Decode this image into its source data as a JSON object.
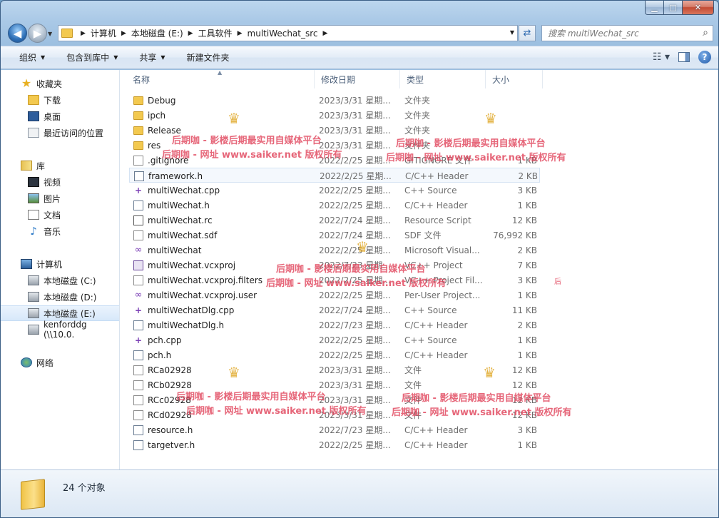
{
  "window": {
    "caption": {
      "minimize": "▁",
      "maximize": "□",
      "close": "✕"
    }
  },
  "nav": {
    "back_glyph": "◀",
    "forward_glyph": "▶",
    "breadcrumb": [
      "计算机",
      "本地磁盘 (E:)",
      "工具软件",
      "multiWechat_src"
    ],
    "search_placeholder": "搜索 multiWechat_src"
  },
  "toolbar": {
    "organize": "组织",
    "include_library": "包含到库中",
    "share": "共享",
    "new_folder": "新建文件夹"
  },
  "sidebar": {
    "favorites": {
      "label": "收藏夹",
      "items": [
        "下载",
        "桌面",
        "最近访问的位置"
      ]
    },
    "libraries": {
      "label": "库",
      "items": [
        "视频",
        "图片",
        "文档",
        "音乐"
      ]
    },
    "computer": {
      "label": "计算机",
      "items": [
        "本地磁盘 (C:)",
        "本地磁盘 (D:)",
        "本地磁盘 (E:)",
        "kenforddg (\\\\10.0."
      ]
    },
    "network": {
      "label": "网络"
    }
  },
  "columns": {
    "name": "名称",
    "date": "修改日期",
    "type": "类型",
    "size": "大小"
  },
  "files": [
    {
      "name": "Debug",
      "date": "2023/3/31 星期...",
      "type": "文件夹",
      "size": "",
      "icon": "folder-icon"
    },
    {
      "name": "ipch",
      "date": "2023/3/31 星期...",
      "type": "文件夹",
      "size": "",
      "icon": "folder-icon"
    },
    {
      "name": "Release",
      "date": "2023/3/31 星期...",
      "type": "文件夹",
      "size": "",
      "icon": "folder-icon"
    },
    {
      "name": "res",
      "date": "2023/3/31 星期...",
      "type": "文件夹",
      "size": "",
      "icon": "folder-icon"
    },
    {
      "name": ".gitignore",
      "date": "2022/2/25 星期...",
      "type": "GITIGNORE 文件",
      "size": "1 KB",
      "icon": "file-icon"
    },
    {
      "name": "framework.h",
      "date": "2022/2/25 星期...",
      "type": "C/C++ Header",
      "size": "2 KB",
      "icon": "header-file-icon"
    },
    {
      "name": "multiWechat.cpp",
      "date": "2022/2/25 星期...",
      "type": "C++ Source",
      "size": "3 KB",
      "icon": "cpp-file-icon"
    },
    {
      "name": "multiWechat.h",
      "date": "2022/2/25 星期...",
      "type": "C/C++ Header",
      "size": "1 KB",
      "icon": "header-file-icon"
    },
    {
      "name": "multiWechat.rc",
      "date": "2022/7/24 星期...",
      "type": "Resource Script",
      "size": "12 KB",
      "icon": "resource-script-icon"
    },
    {
      "name": "multiWechat.sdf",
      "date": "2022/7/24 星期...",
      "type": "SDF 文件",
      "size": "76,992 KB",
      "icon": "file-icon"
    },
    {
      "name": "multiWechat",
      "date": "2022/2/25 星期...",
      "type": "Microsoft Visual...",
      "size": "2 KB",
      "icon": "visual-studio-icon"
    },
    {
      "name": "multiWechat.vcxproj",
      "date": "2022/7/23 星期...",
      "type": "VC++ Project",
      "size": "7 KB",
      "icon": "vc-project-icon"
    },
    {
      "name": "multiWechat.vcxproj.filters",
      "date": "2022/2/25 星期...",
      "type": "VC++ Project Fil...",
      "size": "3 KB",
      "icon": "project-filters-icon"
    },
    {
      "name": "multiWechat.vcxproj.user",
      "date": "2022/2/25 星期...",
      "type": "Per-User Project...",
      "size": "1 KB",
      "icon": "visual-studio-icon"
    },
    {
      "name": "multiWechatDlg.cpp",
      "date": "2022/7/24 星期...",
      "type": "C++ Source",
      "size": "11 KB",
      "icon": "cpp-file-icon"
    },
    {
      "name": "multiWechatDlg.h",
      "date": "2022/7/23 星期...",
      "type": "C/C++ Header",
      "size": "2 KB",
      "icon": "header-file-icon"
    },
    {
      "name": "pch.cpp",
      "date": "2022/2/25 星期...",
      "type": "C++ Source",
      "size": "1 KB",
      "icon": "cpp-file-icon"
    },
    {
      "name": "pch.h",
      "date": "2022/2/25 星期...",
      "type": "C/C++ Header",
      "size": "1 KB",
      "icon": "header-file-icon"
    },
    {
      "name": "RCa02928",
      "date": "2023/3/31 星期...",
      "type": "文件",
      "size": "12 KB",
      "icon": "file-icon"
    },
    {
      "name": "RCb02928",
      "date": "2023/3/31 星期...",
      "type": "文件",
      "size": "12 KB",
      "icon": "file-icon"
    },
    {
      "name": "RCc02928",
      "date": "2023/3/31 星期...",
      "type": "文件",
      "size": "12 KB",
      "icon": "file-icon"
    },
    {
      "name": "RCd02928",
      "date": "2023/3/31 星期...",
      "type": "文件",
      "size": "12 KB",
      "icon": "file-icon"
    },
    {
      "name": "resource.h",
      "date": "2022/7/23 星期...",
      "type": "C/C++ Header",
      "size": "3 KB",
      "icon": "header-file-icon"
    },
    {
      "name": "targetver.h",
      "date": "2022/2/25 星期...",
      "type": "C/C++ Header",
      "size": "1 KB",
      "icon": "header-file-icon"
    }
  ],
  "status": {
    "count": "24 个对象"
  },
  "watermark": {
    "line1": "后期咖 - 影楼后期最实用自媒体平台",
    "line2": "后期咖 - 网址 www.saiker.net 版权所有",
    "fragment": "后"
  }
}
